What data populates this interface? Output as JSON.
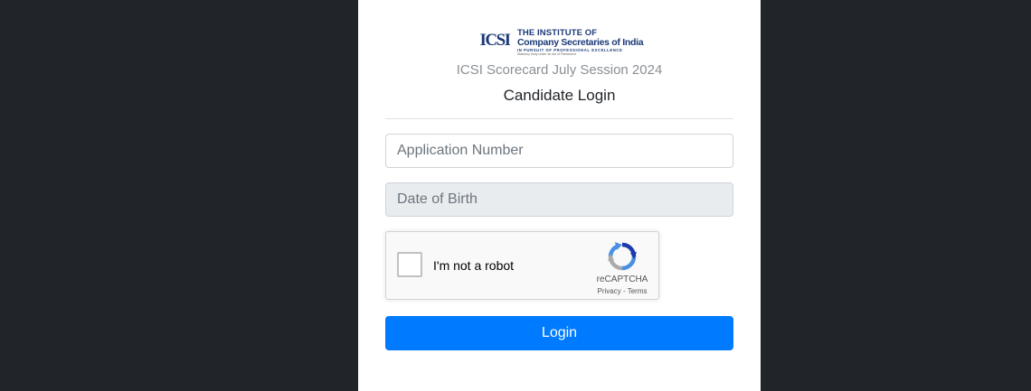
{
  "header": {
    "logo": {
      "mark": "ICSI",
      "line1": "THE INSTITUTE OF",
      "line2": "Company Secretaries of India",
      "line3": "IN PURSUIT OF PROFESSIONAL EXCELLENCE",
      "line4": "Statutory body under an Act of Parliament"
    },
    "subtitle": "ICSI Scorecard July Session 2024",
    "title": "Candidate Login"
  },
  "form": {
    "application_number": {
      "value": "",
      "placeholder": "Application Number"
    },
    "date_of_birth": {
      "value": "",
      "placeholder": "Date of Birth"
    },
    "captcha": {
      "label": "I'm not a robot",
      "brand": "reCAPTCHA",
      "privacy": "Privacy",
      "separator": " - ",
      "terms": "Terms"
    },
    "submit_label": "Login"
  },
  "colors": {
    "page_background": "#212529",
    "card_background": "#ffffff",
    "primary": "#007bff",
    "logo_blue": "#1c3a78",
    "disabled_field": "#e9ecef"
  },
  "icons": {
    "logo": "icsi-logo-icon",
    "captcha": "recaptcha-icon"
  }
}
